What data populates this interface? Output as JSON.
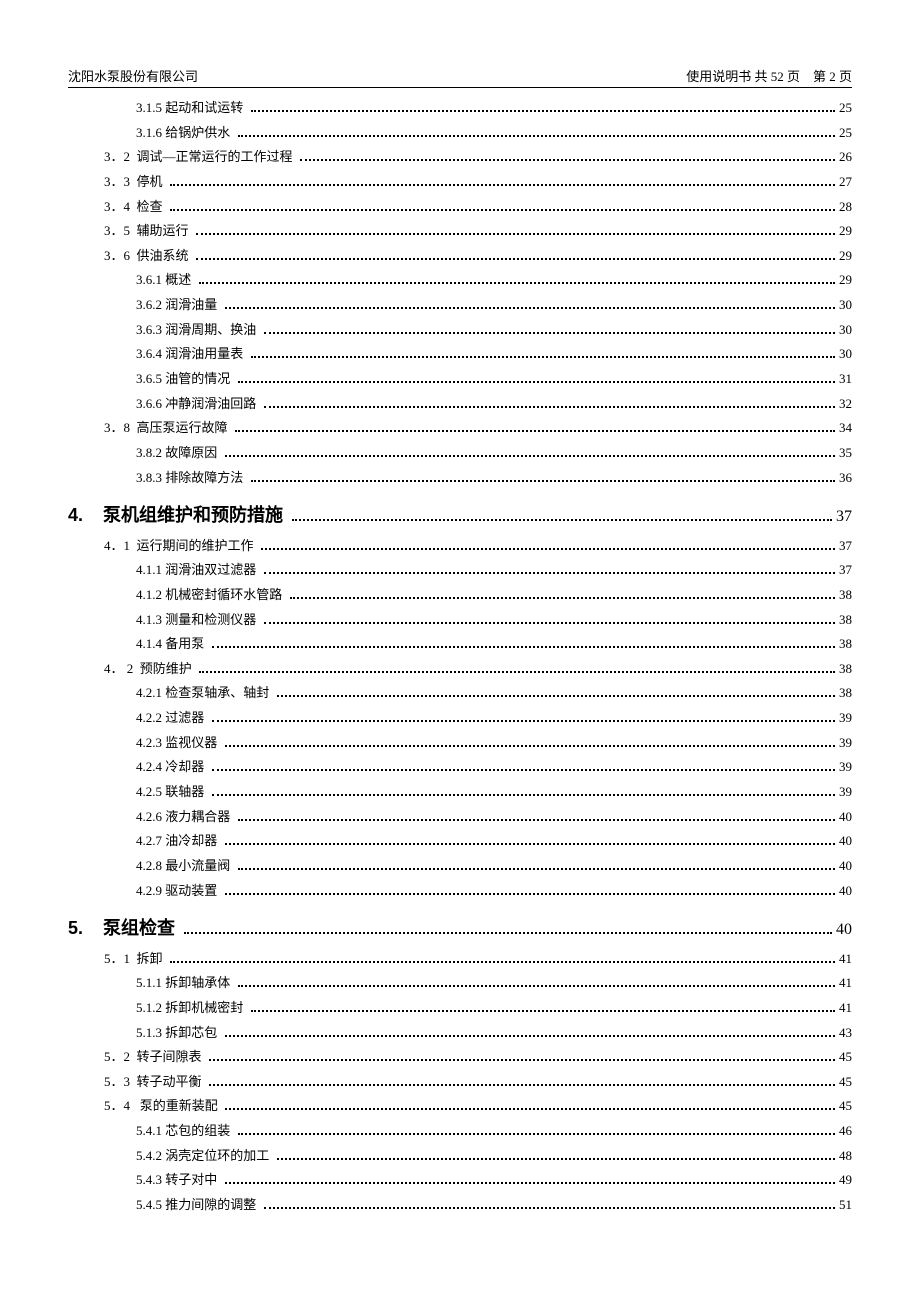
{
  "header": {
    "left": "沈阳水泵股份有限公司",
    "right": "使用说明书 共 52 页    第 2 页"
  },
  "toc": [
    {
      "level": 3,
      "label": "3.1.5 起动和试运转",
      "page": "25"
    },
    {
      "level": 3,
      "label": "3.1.6 给锅炉供水",
      "page": "25"
    },
    {
      "level": 2,
      "label": "3．2  调试—正常运行的工作过程",
      "page": "26"
    },
    {
      "level": 2,
      "label": "3．3  停机",
      "page": "27"
    },
    {
      "level": 2,
      "label": "3．4  检查",
      "page": "28"
    },
    {
      "level": 2,
      "label": "3．5  辅助运行",
      "page": "29"
    },
    {
      "level": 2,
      "label": "3．6  供油系统",
      "page": "29"
    },
    {
      "level": 3,
      "label": "3.6.1 概述",
      "page": "29"
    },
    {
      "level": 3,
      "label": "3.6.2 润滑油量",
      "page": "30"
    },
    {
      "level": 3,
      "label": "3.6.3 润滑周期、换油",
      "page": "30"
    },
    {
      "level": 3,
      "label": "3.6.4 润滑油用量表",
      "page": "30"
    },
    {
      "level": 3,
      "label": "3.6.5 油管的情况",
      "page": "31"
    },
    {
      "level": 3,
      "label": "3.6.6 冲静润滑油回路",
      "page": "32"
    },
    {
      "level": 2,
      "label": "3．8  高压泵运行故障",
      "page": "34"
    },
    {
      "level": 3,
      "label": "3.8.2 故障原因",
      "page": "35"
    },
    {
      "level": 3,
      "label": "3.8.3 排除故障方法",
      "page": "36"
    },
    {
      "level": 1,
      "label": "4.    泵机组维护和预防措施",
      "page": "37"
    },
    {
      "level": 2,
      "label": "4．1  运行期间的维护工作",
      "page": "37"
    },
    {
      "level": 3,
      "label": "4.1.1 润滑油双过滤器",
      "page": "37"
    },
    {
      "level": 3,
      "label": "4.1.2 机械密封循环水管路",
      "page": "38"
    },
    {
      "level": 3,
      "label": "4.1.3 测量和检测仪器",
      "page": "38"
    },
    {
      "level": 3,
      "label": "4.1.4 备用泵",
      "page": "38"
    },
    {
      "level": 2,
      "label": "4． 2  预防维护",
      "page": "38"
    },
    {
      "level": 3,
      "label": "4.2.1 检查泵轴承、轴封",
      "page": "38"
    },
    {
      "level": 3,
      "label": "4.2.2 过滤器",
      "page": "39"
    },
    {
      "level": 3,
      "label": "4.2.3 监视仪器",
      "page": "39"
    },
    {
      "level": 3,
      "label": "4.2.4 冷却器",
      "page": "39"
    },
    {
      "level": 3,
      "label": "4.2.5 联轴器",
      "page": "39"
    },
    {
      "level": 3,
      "label": "4.2.6 液力耦合器",
      "page": "40"
    },
    {
      "level": 3,
      "label": "4.2.7 油冷却器",
      "page": "40"
    },
    {
      "level": 3,
      "label": "4.2.8 最小流量阀",
      "page": "40"
    },
    {
      "level": 3,
      "label": "4.2.9 驱动装置",
      "page": "40"
    },
    {
      "level": 1,
      "label": "5.    泵组检查",
      "page": "40"
    },
    {
      "level": 2,
      "label": "5．1  拆卸",
      "page": "41"
    },
    {
      "level": 3,
      "label": "5.1.1 拆卸轴承体",
      "page": "41"
    },
    {
      "level": 3,
      "label": "5.1.2 拆卸机械密封",
      "page": "41"
    },
    {
      "level": 3,
      "label": "5.1.3 拆卸芯包",
      "page": "43"
    },
    {
      "level": 2,
      "label": "5．2  转子间隙表",
      "page": "45"
    },
    {
      "level": 2,
      "label": "5．3  转子动平衡",
      "page": "45"
    },
    {
      "level": 2,
      "label": "5．4   泵的重新装配",
      "page": "45"
    },
    {
      "level": 3,
      "label": "5.4.1 芯包的组装",
      "page": "46"
    },
    {
      "level": 3,
      "label": "5.4.2 涡壳定位环的加工",
      "page": "48"
    },
    {
      "level": 3,
      "label": "5.4.3 转子对中",
      "page": "49"
    },
    {
      "level": 3,
      "label": "5.4.5 推力间隙的调整",
      "page": "51"
    }
  ]
}
